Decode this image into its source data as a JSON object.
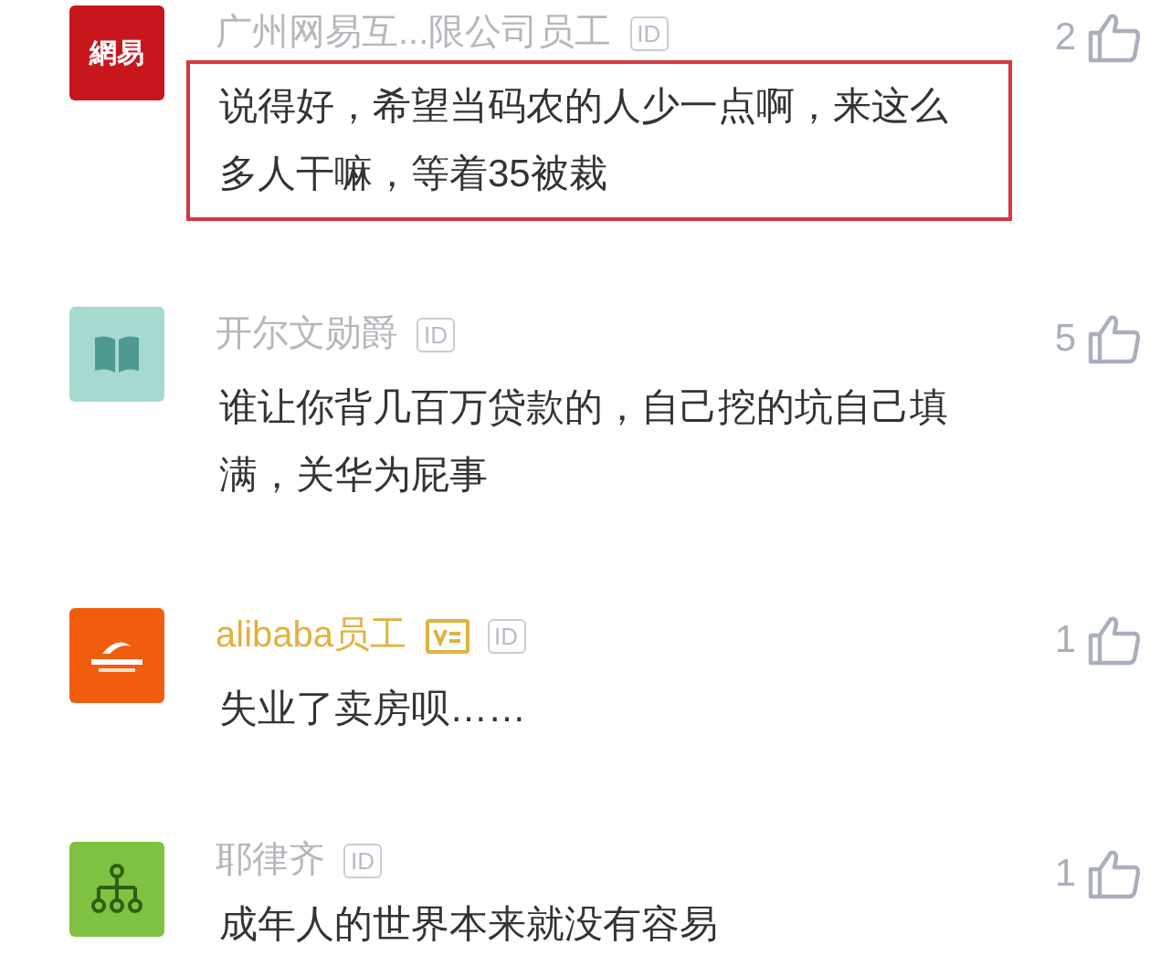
{
  "comments": [
    {
      "kind": "netease",
      "avatar_text": "網易",
      "name": "广州网易互...限公司员工",
      "vip": false,
      "id_badge": "ID",
      "highlighted": true,
      "text": "说得好，希望当码农的人少一点啊，来这么多人干嘛，等着35被裁",
      "likes": "2"
    },
    {
      "kind": "book",
      "name": "开尔文勋爵",
      "vip": false,
      "id_badge": "ID",
      "highlighted": false,
      "text": "谁让你背几百万贷款的，自己挖的坑自己填满，关华为屁事",
      "likes": "5"
    },
    {
      "kind": "alibaba",
      "name": "alibaba员工",
      "vip": true,
      "id_badge": "ID",
      "highlighted": false,
      "text": "失业了卖房呗……",
      "likes": "1"
    },
    {
      "kind": "tree",
      "name": "耶律齐",
      "vip": false,
      "id_badge": "ID",
      "highlighted": false,
      "text": "成年人的世界本来就没有容易",
      "likes": "1"
    }
  ]
}
